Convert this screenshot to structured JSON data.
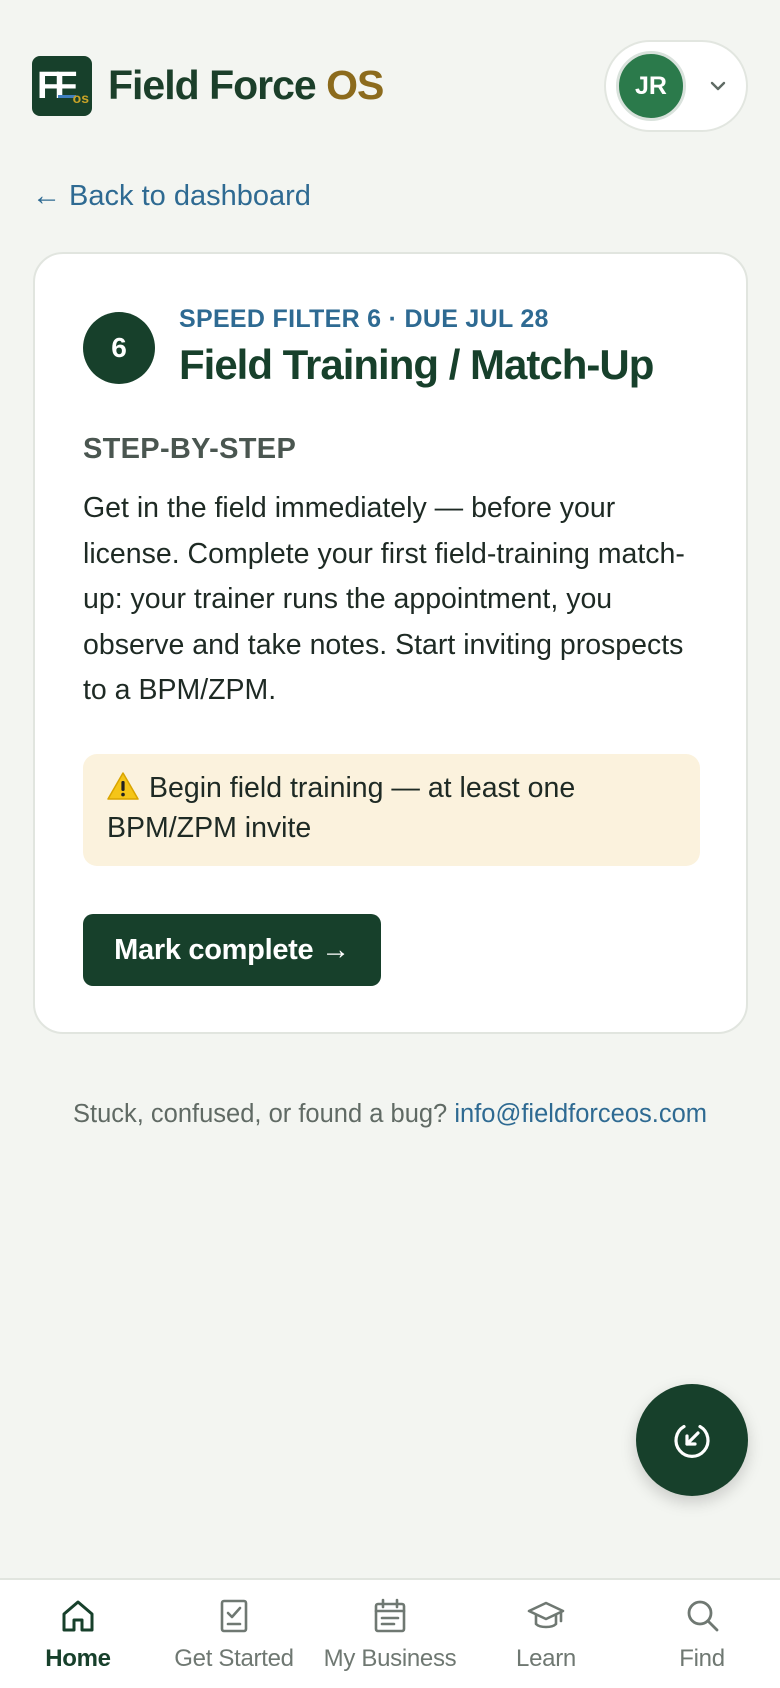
{
  "header": {
    "logo": {
      "letters": "FF",
      "suffix": "os"
    },
    "brand_primary": "Field Force",
    "brand_accent": "OS",
    "user_initials": "JR"
  },
  "back_link": "← Back to dashboard",
  "card": {
    "step_number": "6",
    "kicker": "SPEED FILTER 6 · DUE JUL 28",
    "title": "Field Training / Match-Up",
    "section_label": "STEP-BY-STEP",
    "body": "Get in the field immediately — before your license. Complete your first field-training match-up: your trainer runs the appointment, you observe and take notes. Start inviting prospects to a BPM/ZPM.",
    "alert_text": "Begin field training — at least one BPM/ZPM invite",
    "button_label": "Mark complete →"
  },
  "help": {
    "prompt": "Stuck, confused, or found a bug?",
    "email": "info@fieldforceos.com"
  },
  "nav": [
    {
      "label": "Home",
      "icon": "home-icon",
      "active": true
    },
    {
      "label": "Get Started",
      "icon": "checklist-icon",
      "active": false
    },
    {
      "label": "My Business",
      "icon": "calendar-icon",
      "active": false
    },
    {
      "label": "Learn",
      "icon": "graduation-cap-icon",
      "active": false
    },
    {
      "label": "Find",
      "icon": "search-icon",
      "active": false
    }
  ],
  "colors": {
    "brand_green": "#17402b",
    "brand_gold": "#8c6b1d",
    "link_blue": "#2e6a92",
    "alert_bg": "#fbf2dd",
    "page_bg": "#f3f5f1"
  }
}
